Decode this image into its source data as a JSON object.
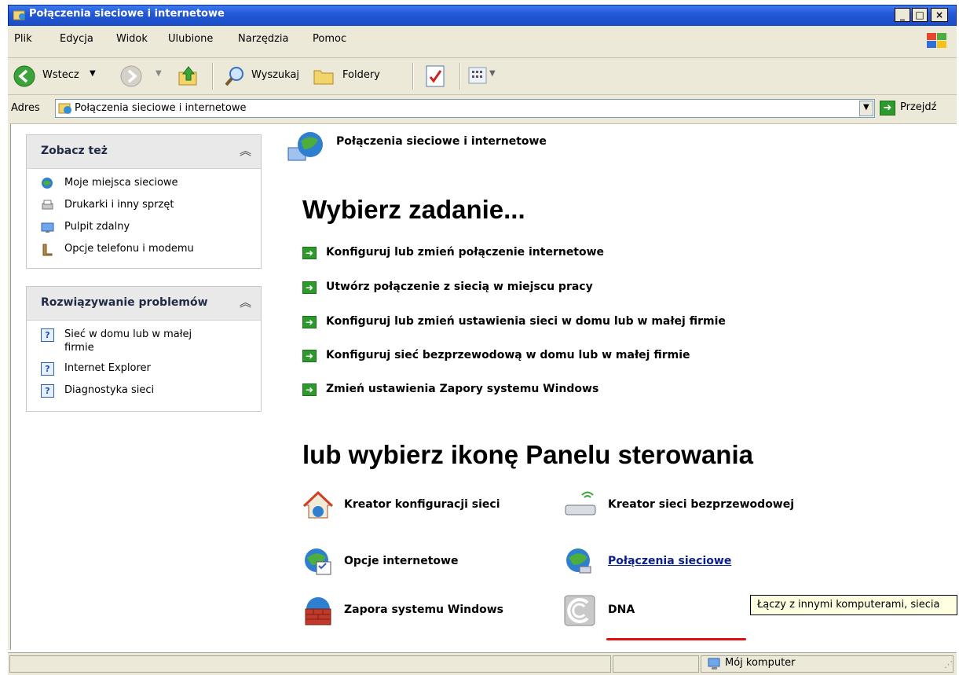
{
  "window": {
    "title": "Połączenia sieciowe i internetowe",
    "min_label": "_",
    "max_label": "□",
    "close_label": "×"
  },
  "menu": [
    "Plik",
    "Edycja",
    "Widok",
    "Ulubione",
    "Narzędzia",
    "Pomoc"
  ],
  "toolbar": {
    "back_label": "Wstecz",
    "search_label": "Wyszukaj",
    "folders_label": "Foldery"
  },
  "address": {
    "label": "Adres",
    "value": "Połączenia sieciowe i internetowe",
    "go_label": "Przejdź"
  },
  "sidebar": {
    "see_also": {
      "title": "Zobacz też",
      "items": [
        {
          "label": "Moje miejsca sieciowe",
          "icon": "network-places-icon"
        },
        {
          "label": "Drukarki i inny sprzęt",
          "icon": "printer-icon"
        },
        {
          "label": "Pulpit zdalny",
          "icon": "remote-desktop-icon"
        },
        {
          "label": "Opcje telefonu i modemu",
          "icon": "phone-icon"
        }
      ]
    },
    "troubleshoot": {
      "title": "Rozwiązywanie problemów",
      "items": [
        {
          "label": "Sieć w domu lub w małej firmie",
          "icon": "help-icon"
        },
        {
          "label": "Internet Explorer",
          "icon": "help-icon"
        },
        {
          "label": "Diagnostyka sieci",
          "icon": "help-icon"
        }
      ]
    }
  },
  "main": {
    "category_title": "Połączenia sieciowe i internetowe",
    "pick_task": "Wybierz zadanie...",
    "tasks": [
      "Konfiguruj lub zmień połączenie internetowe",
      "Utwórz połączenie z siecią w miejscu pracy",
      "Konfiguruj lub zmień ustawienia sieci w domu lub w małej firmie",
      "Konfiguruj sieć bezprzewodową w domu lub w małej firmie",
      "Zmień ustawienia Zapory systemu Windows"
    ],
    "or_pick_icon": "lub wybierz ikonę Panelu sterowania",
    "icons": [
      {
        "label": "Kreator konfiguracji sieci",
        "icon": "network-setup-wizard-icon"
      },
      {
        "label": "Kreator sieci bezprzewodowej",
        "icon": "wireless-wizard-icon"
      },
      {
        "label": "Opcje internetowe",
        "icon": "internet-options-icon"
      },
      {
        "label": "Połączenia sieciowe",
        "icon": "network-connections-icon"
      },
      {
        "label": "Zapora systemu Windows",
        "icon": "firewall-icon"
      },
      {
        "label": "DNA",
        "icon": "dna-icon"
      }
    ],
    "tooltip": "Łączy z innymi komputerami, siecia"
  },
  "status": {
    "zone": "Mój komputer"
  },
  "colors": {
    "title_bar": "#2358d6",
    "chrome": "#ece9d8",
    "task_arrow": "#2e9a2e",
    "link": "#0a1f8a",
    "highlight_underline": "#e01010"
  }
}
